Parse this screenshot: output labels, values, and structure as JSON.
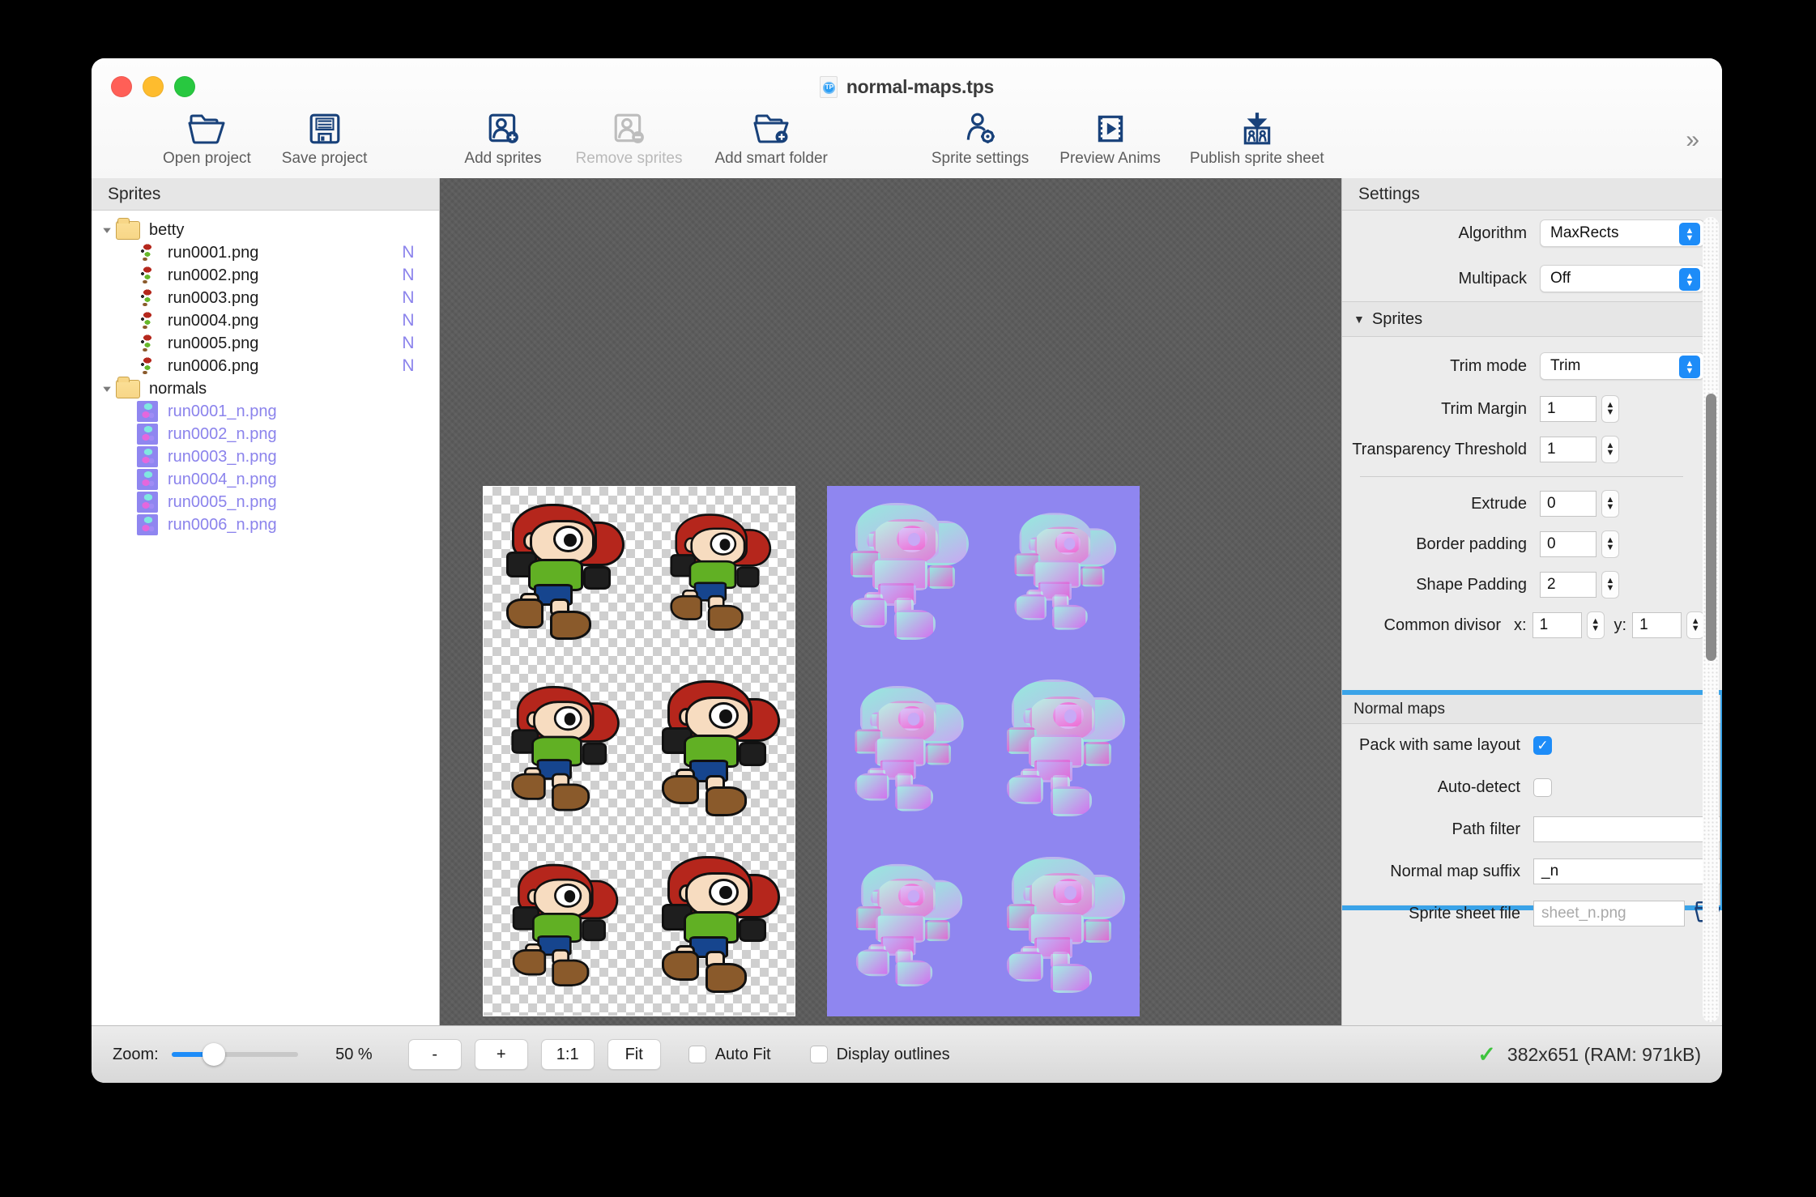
{
  "window": {
    "title": "normal-maps.tps",
    "doc_icon_label": "TP",
    "traffic": {
      "close": "close-button",
      "minimize": "minimize-button",
      "maximize": "maximize-button"
    }
  },
  "toolbar": {
    "expand_glyph": "»",
    "items": [
      {
        "label": "Open project",
        "icon": "open-folder-icon",
        "enabled": true
      },
      {
        "label": "Save project",
        "icon": "floppy-disk-icon",
        "enabled": true
      },
      {
        "label": "Add sprites",
        "icon": "add-sprite-icon",
        "enabled": true
      },
      {
        "label": "Remove sprites",
        "icon": "remove-sprite-icon",
        "enabled": false
      },
      {
        "label": "Add smart folder",
        "icon": "add-smart-folder-icon",
        "enabled": true
      },
      {
        "label": "Sprite settings",
        "icon": "sprite-settings-icon",
        "enabled": true
      },
      {
        "label": "Preview Anims",
        "icon": "preview-anims-icon",
        "enabled": true
      },
      {
        "label": "Publish sprite sheet",
        "icon": "publish-sprite-sheet-icon",
        "enabled": true
      }
    ]
  },
  "sidebar": {
    "header": "Sprites",
    "groups": [
      {
        "name": "betty",
        "expanded": true,
        "files": [
          {
            "name": "run0001.png",
            "badge": "N"
          },
          {
            "name": "run0002.png",
            "badge": "N"
          },
          {
            "name": "run0003.png",
            "badge": "N"
          },
          {
            "name": "run0004.png",
            "badge": "N"
          },
          {
            "name": "run0005.png",
            "badge": "N"
          },
          {
            "name": "run0006.png",
            "badge": "N"
          }
        ]
      },
      {
        "name": "normals",
        "expanded": true,
        "files": [
          {
            "name": "run0001_n.png",
            "badge": ""
          },
          {
            "name": "run0002_n.png",
            "badge": ""
          },
          {
            "name": "run0003_n.png",
            "badge": ""
          },
          {
            "name": "run0004_n.png",
            "badge": ""
          },
          {
            "name": "run0005_n.png",
            "badge": ""
          },
          {
            "name": "run0006_n.png",
            "badge": ""
          }
        ]
      }
    ]
  },
  "canvas": {
    "diffuse_sheet_alt": "betty run cycle sprite sheet, 2 columns x 3 rows, transparent checkerboard background",
    "normal_sheet_alt": "normal map sprite sheet, 2 columns x 3 rows, lavender background"
  },
  "settings": {
    "header": "Settings",
    "algorithm": {
      "label": "Algorithm",
      "value": "MaxRects"
    },
    "multipack": {
      "label": "Multipack",
      "value": "Off"
    },
    "sprites_group": {
      "label": "Sprites",
      "expanded": true
    },
    "trim_mode": {
      "label": "Trim mode",
      "value": "Trim"
    },
    "trim_margin": {
      "label": "Trim Margin",
      "value": "1"
    },
    "transparency_threshold": {
      "label": "Transparency Threshold",
      "value": "1"
    },
    "extrude": {
      "label": "Extrude",
      "value": "0"
    },
    "border_padding": {
      "label": "Border padding",
      "value": "0"
    },
    "shape_padding": {
      "label": "Shape Padding",
      "value": "2"
    },
    "common_divisor": {
      "label": "Common divisor",
      "x_label": "x:",
      "x_value": "1",
      "y_label": "y:",
      "y_value": "1"
    },
    "normal_maps": {
      "header": "Normal maps",
      "highlight_color": "#3aa3e8",
      "pack_same_layout": {
        "label": "Pack with same layout",
        "checked": true,
        "glyph": "✓"
      },
      "auto_detect": {
        "label": "Auto-detect",
        "checked": false
      },
      "path_filter": {
        "label": "Path filter",
        "value": "",
        "placeholder": ""
      },
      "normal_map_suffix": {
        "label": "Normal map suffix",
        "value": "_n"
      },
      "sprite_sheet_file": {
        "label": "Sprite sheet file",
        "value": "",
        "placeholder": "sheet_n.png",
        "browse_icon": "open-folder-icon"
      }
    }
  },
  "statusbar": {
    "zoom_label": "Zoom:",
    "zoom_value": "50 %",
    "zoom_percent": 50,
    "minus_label": "-",
    "plus_label": "+",
    "one_to_one_label": "1:1",
    "fit_label": "Fit",
    "auto_fit": {
      "label": "Auto Fit",
      "checked": false
    },
    "display_outlines": {
      "label": "Display outlines",
      "checked": false
    },
    "status_icon": "green-check-icon",
    "status_text": "382x651 (RAM: 971kB)"
  }
}
